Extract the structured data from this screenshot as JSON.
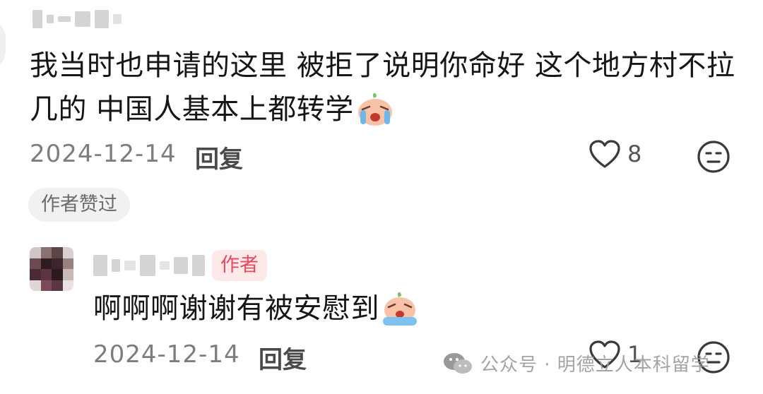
{
  "comments": [
    {
      "body_line1": "我当时也申请的这里 被拒了说明你命好 这个地方村不拉",
      "body_line2": "几的 中国人基本上都转学",
      "emoji": "crying-face-emoji",
      "date": "2024-12-14",
      "reply_label": "回复",
      "like_count": "8",
      "liked_badge": "作者赞过"
    }
  ],
  "reply": {
    "author_badge": "作者",
    "body": "啊啊啊谢谢有被安慰到",
    "emoji": "crying-face-emoji",
    "date": "2024-12-14",
    "reply_label": "回复",
    "like_count": "1"
  },
  "watermark": {
    "text": "公众号 · 明德立人本科留学",
    "icon": "wechat-icon"
  },
  "colors": {
    "author_badge_text": "#e8485c",
    "author_badge_bg": "#fde8ea",
    "meta_text": "#7d7d7d"
  }
}
